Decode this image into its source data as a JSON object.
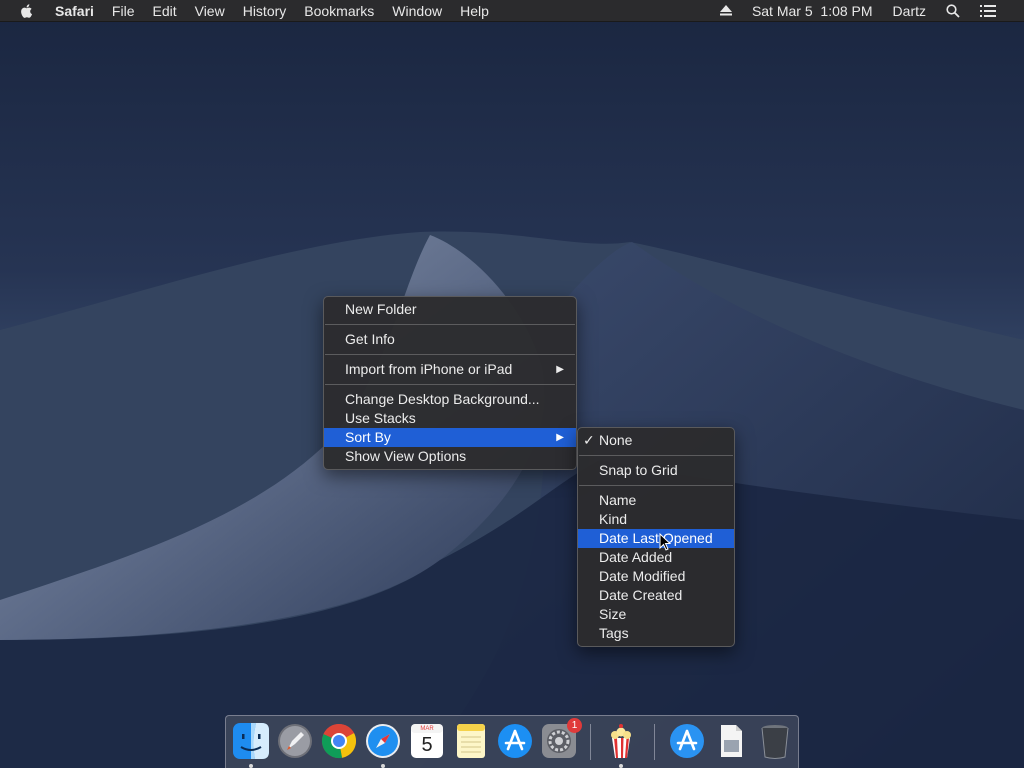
{
  "menubar": {
    "app_name": "Safari",
    "menus": [
      "File",
      "Edit",
      "View",
      "History",
      "Bookmarks",
      "Window",
      "Help"
    ],
    "datetime": "Sat Mar 5  1:08 PM",
    "user": "Dartz",
    "icons": [
      "apple-icon",
      "eject-icon",
      "search-icon",
      "list-icon"
    ]
  },
  "context_menu": {
    "items": [
      "New Folder",
      "Get Info",
      "Import from iPhone or iPad",
      "Change Desktop Background...",
      "Use Stacks",
      "Sort By",
      "Show View Options"
    ],
    "highlighted": "Sort By"
  },
  "sort_by_submenu": {
    "items": [
      "None",
      "Snap to Grid",
      "Name",
      "Kind",
      "Date Last Opened",
      "Date Added",
      "Date Modified",
      "Date Created",
      "Size",
      "Tags"
    ],
    "checked": "None",
    "highlighted": "Date Last Opened"
  },
  "dock": {
    "apps": [
      "finder-icon",
      "launchpad-icon",
      "chrome-icon",
      "safari-icon",
      "calendar-icon",
      "notes-icon",
      "app-store-icon",
      "system-preferences-icon",
      "popcorn-app-icon",
      "app-store-folder-icon",
      "document-icon",
      "trash-icon"
    ],
    "calendar": {
      "month": "MAR",
      "day": "5"
    },
    "system_preferences_badge": "1"
  }
}
